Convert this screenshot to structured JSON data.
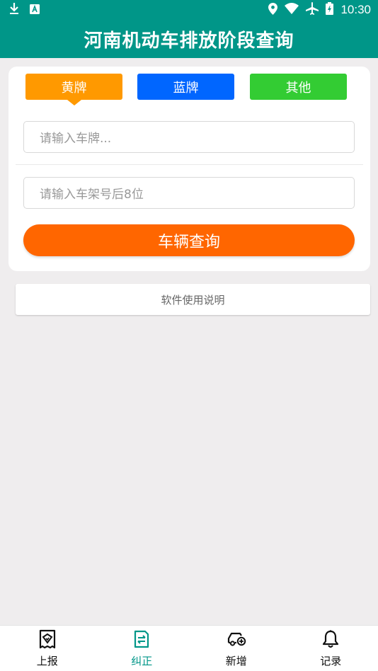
{
  "status_bar": {
    "time": "10:30",
    "left_icons": [
      "download-icon",
      "a-notification-icon"
    ],
    "right_icons": [
      "location-icon",
      "wifi-icon",
      "airplane-icon",
      "battery-icon"
    ]
  },
  "header": {
    "title": "河南机动车排放阶段查询"
  },
  "plate_types": [
    {
      "label": "黄牌",
      "color": "#FF9900",
      "selected": true
    },
    {
      "label": "蓝牌",
      "color": "#0066FF",
      "selected": false
    },
    {
      "label": "其他",
      "color": "#33CC33",
      "selected": false
    }
  ],
  "form": {
    "plate_placeholder": "请输入车牌...",
    "vin_placeholder": "请输入车架号后8位",
    "query_label": "车辆查询"
  },
  "help": {
    "label": "软件使用说明"
  },
  "bottom_nav": [
    {
      "label": "上报",
      "icon": "report-icon",
      "active": false
    },
    {
      "label": "纠正",
      "icon": "correct-icon",
      "active": true
    },
    {
      "label": "新增",
      "icon": "add-vehicle-icon",
      "active": false
    },
    {
      "label": "记录",
      "icon": "bell-icon",
      "active": false
    }
  ],
  "colors": {
    "primary": "#009688",
    "query_button": "#FF6600",
    "background": "#EFEDEE"
  }
}
